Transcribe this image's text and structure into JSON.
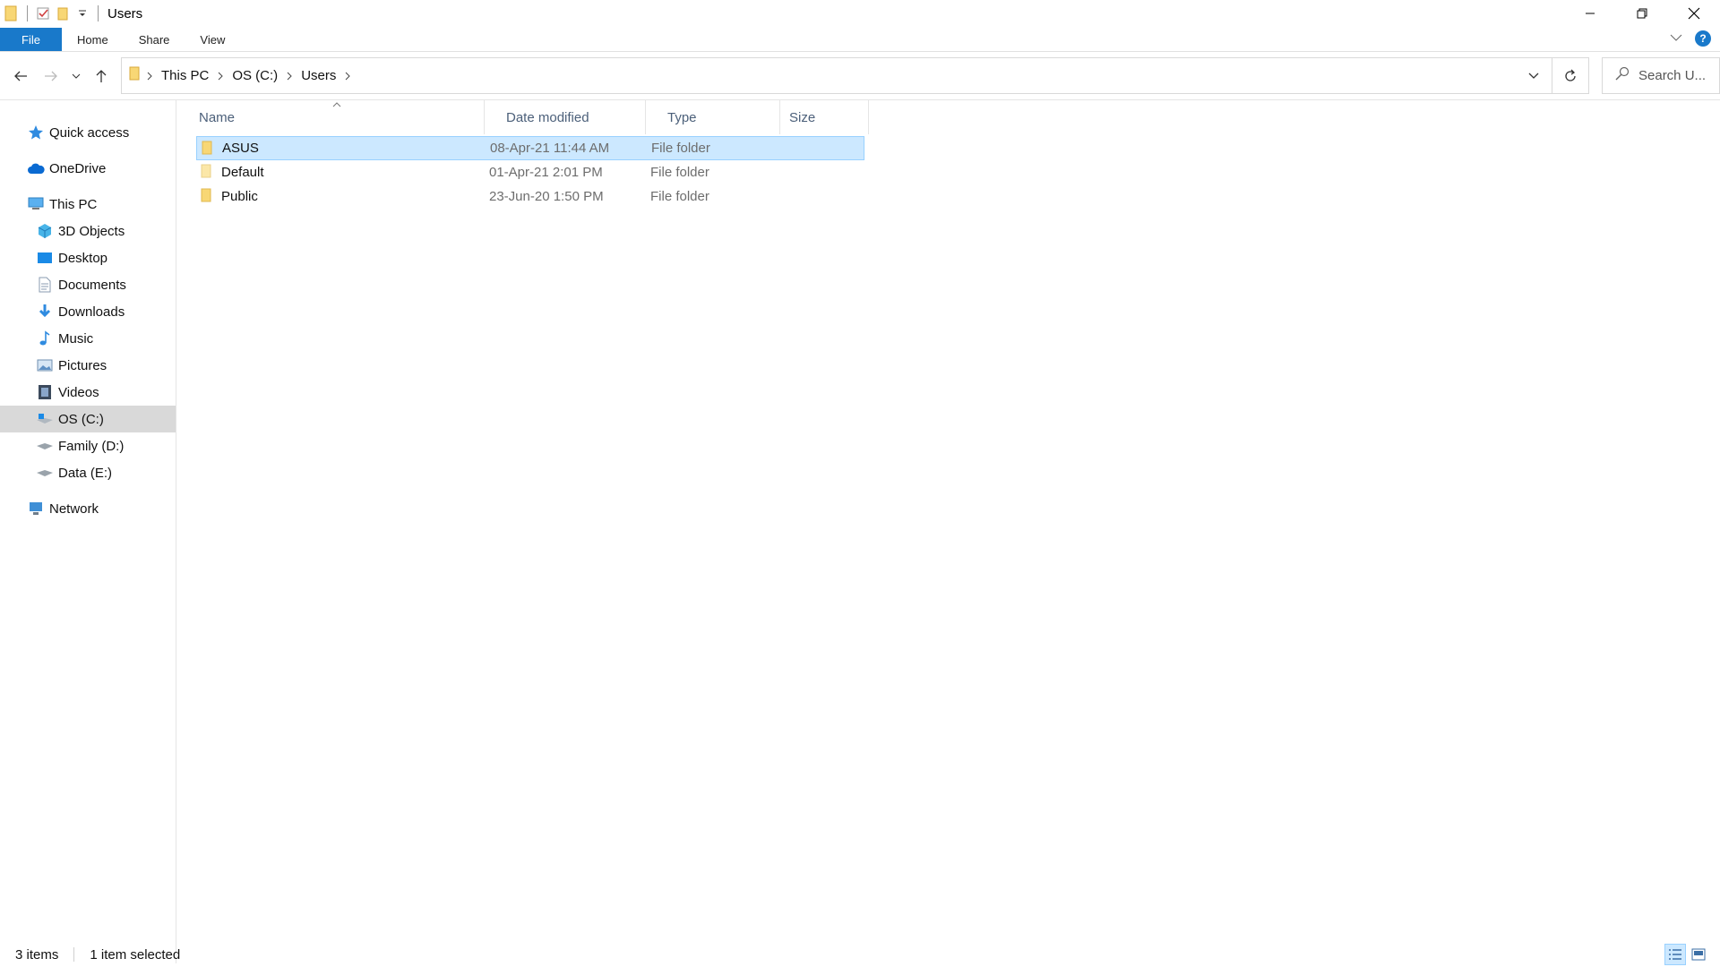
{
  "window": {
    "title": "Users"
  },
  "ribbon": {
    "file": "File",
    "tabs": [
      "Home",
      "Share",
      "View"
    ],
    "help": "?"
  },
  "address": {
    "crumbs": [
      "This PC",
      "OS (C:)",
      "Users"
    ],
    "search_placeholder": "Search U..."
  },
  "sidebar": {
    "quick_access": "Quick access",
    "onedrive": "OneDrive",
    "this_pc": "This PC",
    "pc_items": [
      "3D Objects",
      "Desktop",
      "Documents",
      "Downloads",
      "Music",
      "Pictures",
      "Videos",
      "OS (C:)",
      "Family (D:)",
      "Data (E:)"
    ],
    "network": "Network"
  },
  "columns": {
    "name": "Name",
    "date": "Date modified",
    "type": "Type",
    "size": "Size"
  },
  "files": [
    {
      "name": "ASUS",
      "date": "08-Apr-21 11:44 AM",
      "type": "File folder",
      "size": ""
    },
    {
      "name": "Default",
      "date": "01-Apr-21 2:01 PM",
      "type": "File folder",
      "size": ""
    },
    {
      "name": "Public",
      "date": "23-Jun-20 1:50 PM",
      "type": "File folder",
      "size": ""
    }
  ],
  "status": {
    "items": "3 items",
    "selected": "1 item selected"
  },
  "colors": {
    "accent": "#1979ca",
    "selection": "#cce8ff",
    "folder": "#f8d775"
  }
}
